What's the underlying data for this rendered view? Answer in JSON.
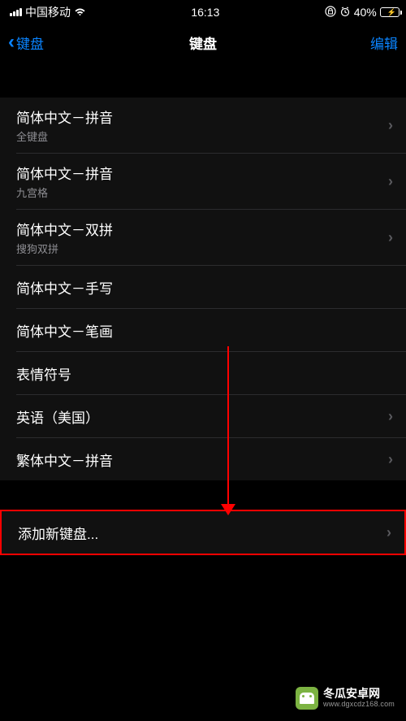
{
  "status": {
    "carrier": "中国移动",
    "time": "16:13",
    "battery_percent": "40%"
  },
  "nav": {
    "back_label": "键盘",
    "title": "键盘",
    "edit_label": "编辑"
  },
  "keyboards": [
    {
      "title": "简体中文－拼音",
      "subtitle": "全键盘"
    },
    {
      "title": "简体中文－拼音",
      "subtitle": "九宫格"
    },
    {
      "title": "简体中文－双拼",
      "subtitle": "搜狗双拼"
    },
    {
      "title": "简体中文－手写",
      "subtitle": null
    },
    {
      "title": "简体中文－笔画",
      "subtitle": null
    },
    {
      "title": "表情符号",
      "subtitle": null
    },
    {
      "title": "英语（美国）",
      "subtitle": null
    },
    {
      "title": "繁体中文－拼音",
      "subtitle": null
    }
  ],
  "add": {
    "label": "添加新键盘..."
  },
  "watermark": {
    "line1": "冬瓜安卓网",
    "line2": "www.dgxcdz168.com"
  }
}
